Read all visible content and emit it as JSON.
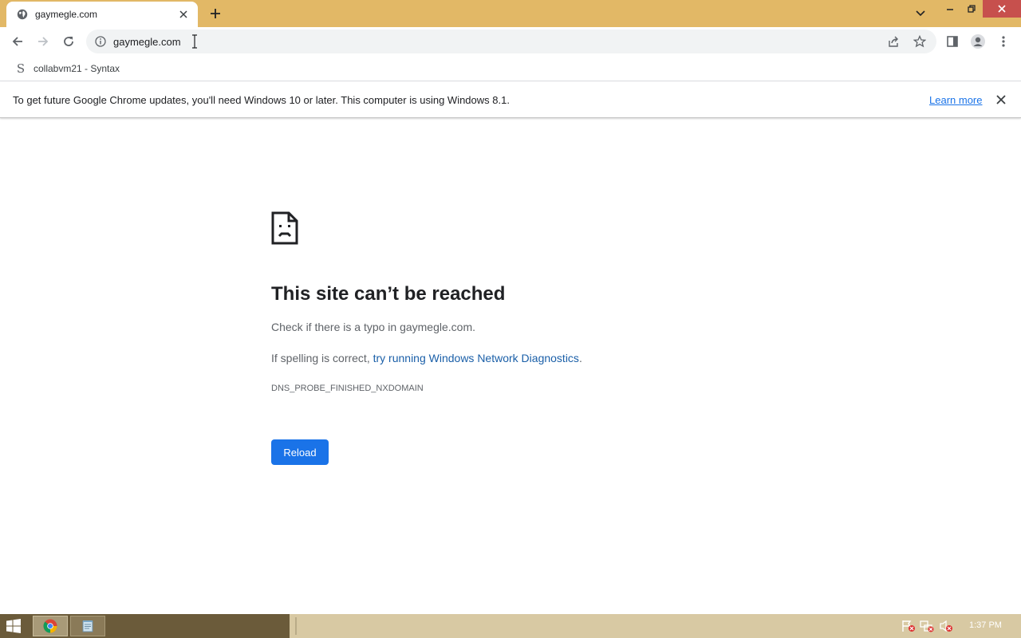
{
  "tab": {
    "title": "gaymegle.com"
  },
  "omnibox": {
    "url": "gaymegle.com"
  },
  "bookmarks": [
    {
      "label": "collabvm21 - Syntax",
      "icon": "S"
    }
  ],
  "infobar": {
    "message": "To get future Google Chrome updates, you'll need Windows 10 or later. This computer is using Windows 8.1.",
    "link": "Learn more"
  },
  "error": {
    "title": "This site can’t be reached",
    "line1": "Check if there is a typo in gaymegle.com.",
    "line2_prefix": "If spelling is correct, ",
    "line2_link": "try running Windows Network Diagnostics",
    "line2_suffix": ".",
    "code": "DNS_PROBE_FINISHED_NXDOMAIN",
    "reload_label": "Reload"
  },
  "taskbar": {
    "clock": "1:37 PM"
  },
  "colors": {
    "frame": "#e2b866",
    "accent": "#1a73e8",
    "taskbar": "#d8c9a3",
    "close_button": "#c7504d"
  }
}
